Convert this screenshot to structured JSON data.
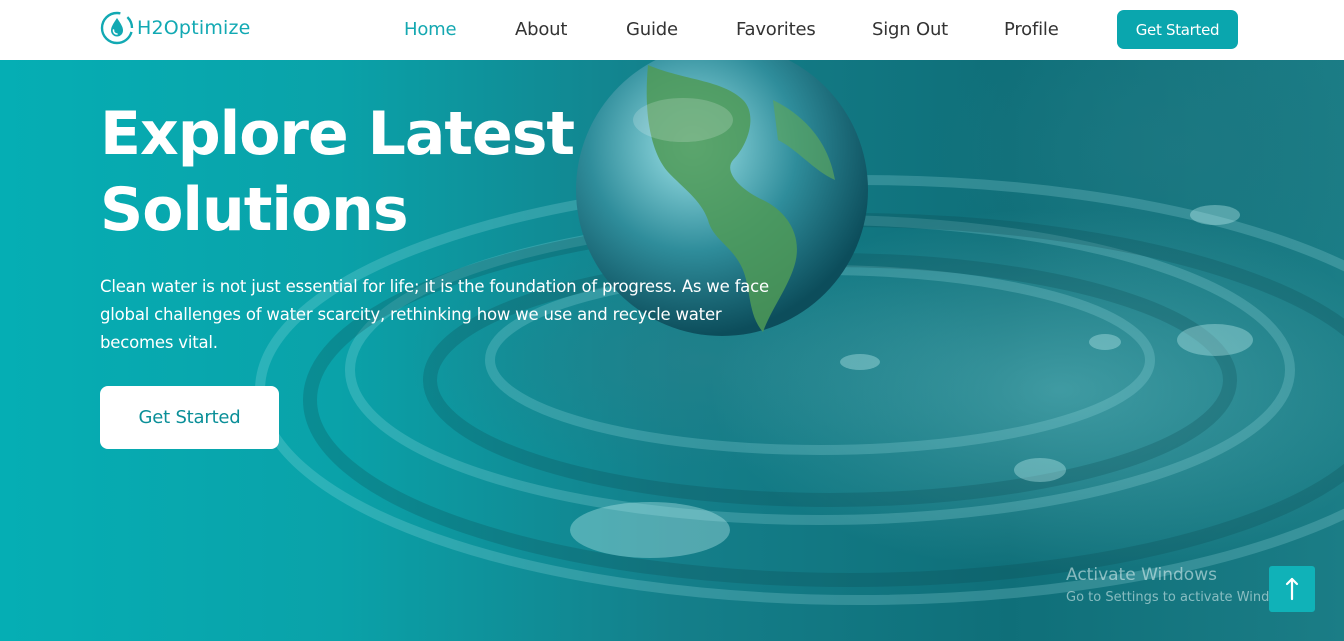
{
  "brand": {
    "name": "H2Optimize",
    "icon": "water-drop-logo-icon",
    "color": "#12a9b3"
  },
  "nav": {
    "items": [
      {
        "label": "Home",
        "active": true
      },
      {
        "label": "About",
        "active": false
      },
      {
        "label": "Guide",
        "active": false
      },
      {
        "label": "Favorites",
        "active": false
      },
      {
        "label": "Sign Out",
        "active": false
      },
      {
        "label": "Profile",
        "active": false
      }
    ],
    "cta_label": "Get Started",
    "active_color": "#15a8b1"
  },
  "hero": {
    "title_line1": "Explore Latest",
    "title_line2": "Solutions",
    "description": "Clean water is not just essential for life; it is the foundation of progress. As we face global challenges of water scarcity, rethinking how we use and recycle water becomes vital.",
    "cta_label": "Get Started",
    "background_image": "earth-water-drop-ripples"
  },
  "watermark": {
    "title": "Activate Windows",
    "subtitle": "Go to Settings to activate Windows."
  },
  "back_to_top": {
    "icon": "arrow-up-icon"
  }
}
